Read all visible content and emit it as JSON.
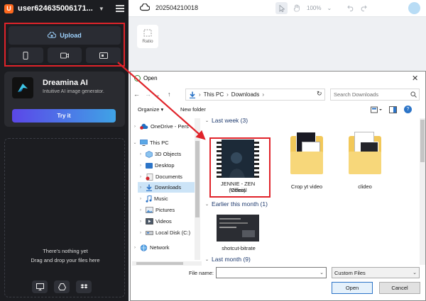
{
  "sidebar": {
    "logo_letter": "U",
    "username": "user624635006171...",
    "upload_label": "Upload",
    "promo": {
      "title": "Dreamina AI",
      "subtitle": "Intuitive AI image generator.",
      "try_label": "Try it"
    },
    "drop_line1": "There's nothing yet",
    "drop_line2": "Drag and drop your files here"
  },
  "topbar": {
    "project_name": "202504210018",
    "zoom": "100%"
  },
  "canvas": {
    "ratio_label": "Ratio"
  },
  "dialog": {
    "title": "Open",
    "address": {
      "root": "This PC",
      "folder": "Downloads"
    },
    "search_placeholder": "Search Downloads",
    "organize_label": "Organize",
    "new_folder_label": "New folder",
    "tree": [
      {
        "label": "OneDrive - Pers",
        "indent": 0
      },
      {
        "label": "This PC",
        "indent": 0
      },
      {
        "label": "3D Objects",
        "indent": 1
      },
      {
        "label": "Desktop",
        "indent": 1
      },
      {
        "label": "Documents",
        "indent": 1
      },
      {
        "label": "Downloads",
        "indent": 1
      },
      {
        "label": "Music",
        "indent": 1
      },
      {
        "label": "Pictures",
        "indent": 1
      },
      {
        "label": "Videos",
        "indent": 1
      },
      {
        "label": "Local Disk (C:)",
        "indent": 1
      },
      {
        "label": "Network",
        "indent": 0
      }
    ],
    "groups": [
      {
        "label": "Last week (3)"
      },
      {
        "label": "Earlier this month (1)"
      },
      {
        "label": "Last month (9)"
      }
    ],
    "files": [
      {
        "name_line1": "JENNIE - ZEN (Official",
        "name_line2": "Video)"
      },
      {
        "name_line1": "Crop yt video",
        "name_line2": ""
      },
      {
        "name_line1": "clideo",
        "name_line2": ""
      },
      {
        "name_line1": "shotcut-bitrate",
        "name_line2": ""
      }
    ],
    "file_name_label": "File name:",
    "file_name_value": "",
    "filter_value": "Custom Files",
    "open_label": "Open",
    "cancel_label": "Cancel"
  },
  "colors": {
    "highlight": "#e0232a",
    "accent_start": "#5b47e8",
    "accent_end": "#3fa3e6"
  }
}
